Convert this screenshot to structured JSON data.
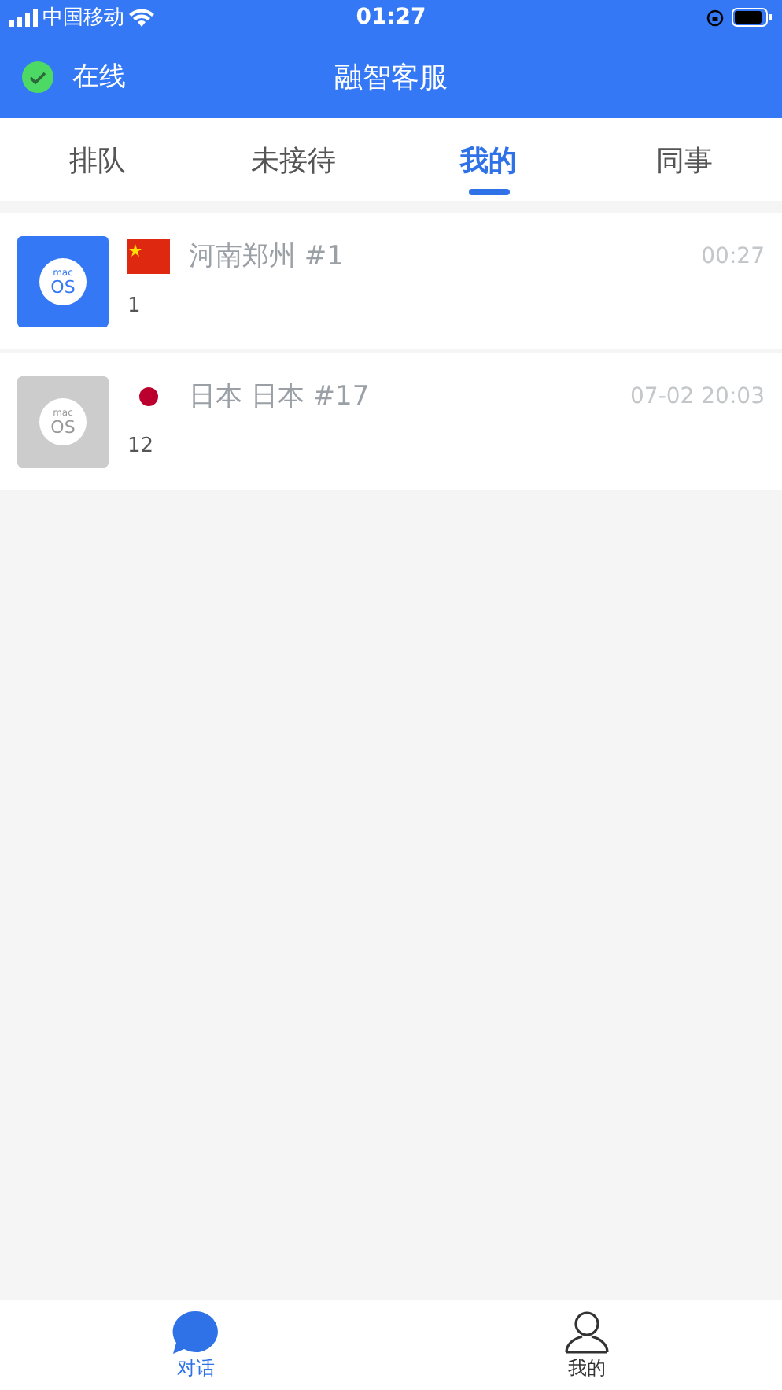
{
  "status_bar": {
    "carrier": "中国移动",
    "time": "01:27"
  },
  "header": {
    "status": "在线",
    "online": true,
    "title": "融智客服"
  },
  "tabs": [
    {
      "label": "排队",
      "selected": false
    },
    {
      "label": "未接待",
      "selected": false
    },
    {
      "label": "我的",
      "selected": true
    },
    {
      "label": "同事",
      "selected": false
    }
  ],
  "conversations": [
    {
      "avatar_top": "mac",
      "avatar_bottom": "OS",
      "active": true,
      "kind": "cn",
      "name": "河南郑州 #1",
      "time": "00:27",
      "count": "1"
    },
    {
      "avatar_top": "mac",
      "avatar_bottom": "OS",
      "active": false,
      "kind": "jp",
      "name": "日本 日本 #17",
      "time": "07-02 20:03",
      "count": "12"
    }
  ],
  "bottom_nav": [
    {
      "label": "对话",
      "kind": "chat",
      "selected": true
    },
    {
      "label": "我的",
      "kind": "profile",
      "selected": false
    }
  ]
}
